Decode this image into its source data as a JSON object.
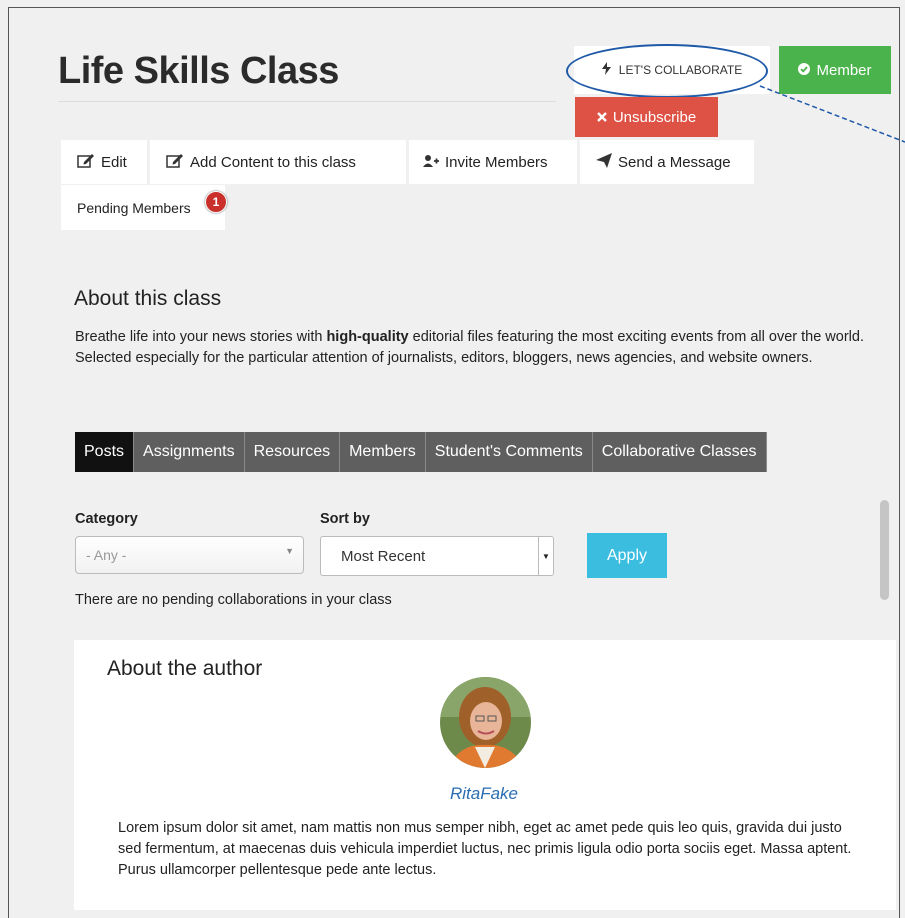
{
  "header": {
    "title": "Life Skills Class",
    "collaborate_label": "LET'S COLLABORATE",
    "member_label": "Member",
    "unsubscribe_label": "Unsubscribe"
  },
  "actions": {
    "edit": "Edit",
    "add_content": "Add Content to this class",
    "invite": "Invite Members",
    "message": "Send a Message",
    "pending": "Pending Members",
    "pending_count": "1"
  },
  "about": {
    "heading": "About this class",
    "p1_before": "Breathe life into your news stories with ",
    "p1_bold": "high-quality",
    "p1_after": " editorial files featuring the most exciting events from all over the world.",
    "p2": "Selected especially for the particular attention of journalists, editors, bloggers, news agencies, and website owners."
  },
  "tabs": [
    "Posts",
    "Assignments",
    "Resources",
    "Members",
    "Student's Comments",
    "Collaborative Classes"
  ],
  "filters": {
    "category_label": "Category",
    "category_value": "- Any -",
    "sort_label": "Sort by",
    "sort_value": "Most Recent",
    "apply_label": "Apply",
    "empty_message": "There are no pending collaborations in your class"
  },
  "author": {
    "heading": "About the author",
    "name": "RitaFake",
    "bio": "Lorem ipsum dolor sit amet, nam mattis non mus semper nibh, eget ac amet pede quis leo quis, gravida dui justo sed fermentum, at maecenas duis vehicula imperdiet luctus, nec primis ligula odio porta sociis eget. Massa aptent. Purus ullamcorper pellentesque pede ante lectus."
  },
  "colors": {
    "member_green": "#4bb34b",
    "unsubscribe_red": "#de5246",
    "apply_blue": "#3bbde0",
    "active_tab": "#111111",
    "tab_gray": "#5f5f5f",
    "author_link": "#2a6db0"
  },
  "icons": [
    "bolt-icon",
    "check-circle-icon",
    "close-icon",
    "edit-icon",
    "add-user-icon",
    "paper-plane-icon",
    "chevron-down-icon"
  ]
}
